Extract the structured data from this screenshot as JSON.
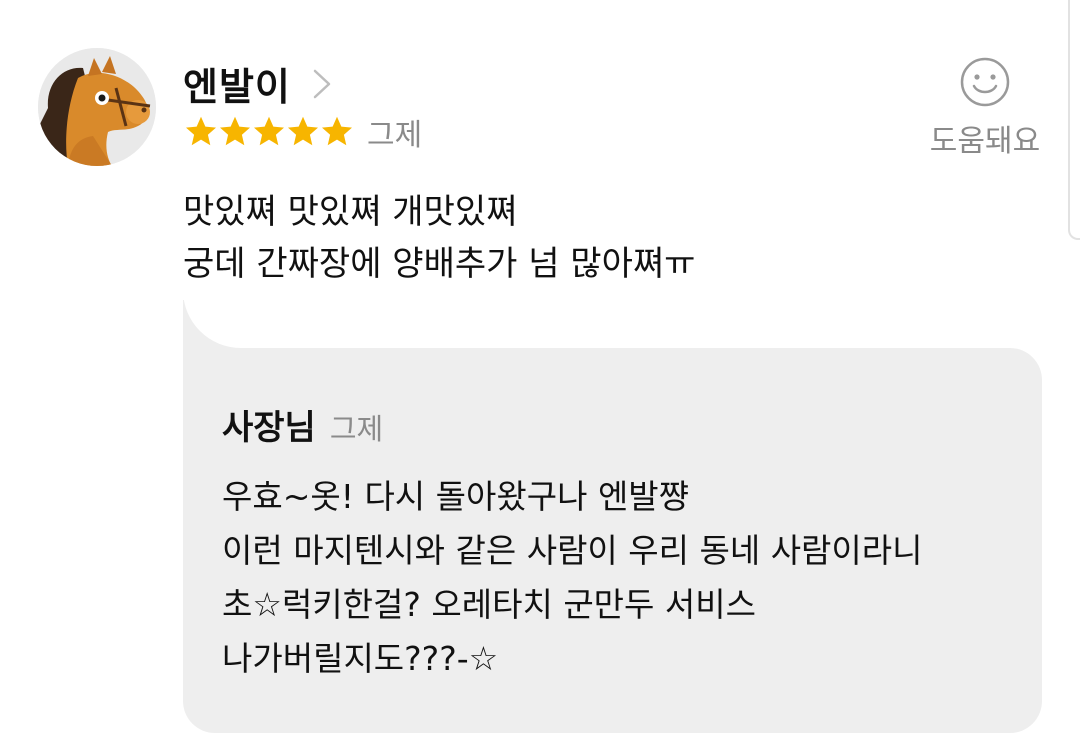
{
  "review": {
    "username": "엔발이",
    "rating": 5,
    "rating_max": 5,
    "date": "그제",
    "helpful_label": "도움돼요",
    "text_lines": [
      "맛있쪄 맛있쪄 개맛있쪄",
      "궁데 간짜장에 양배추가 넘 많아쪄ㅠ"
    ]
  },
  "reply": {
    "author": "사장님",
    "date": "그제",
    "text_lines": [
      "우효~옷! 다시 돌아왔구나 엔발쨩",
      "이런 마지텐시와 같은 사람이 우리 동네 사람이라니",
      "초☆럭키한걸? 오레타치 군만두 서비스",
      "나가버릴지도???-☆"
    ]
  },
  "icons": {
    "avatar": "horse-toy-avatar",
    "username_chevron": "chevron-right-icon",
    "star": "star-icon",
    "helpful": "smiley-icon"
  },
  "colors": {
    "star": "#f7b500",
    "muted_text": "#8a8a8a",
    "reply_background": "#eeeeee",
    "text": "#111111"
  }
}
